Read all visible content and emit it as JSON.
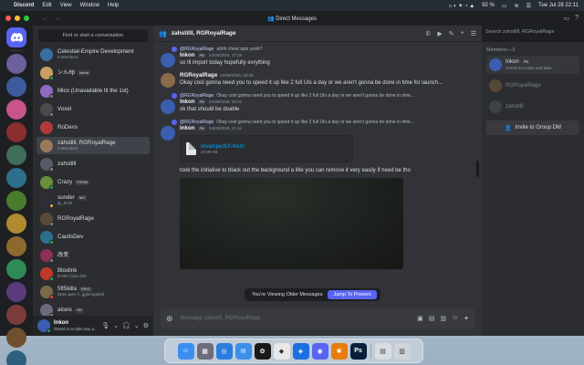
{
  "menubar": {
    "app_name": "Discord",
    "menus": [
      "Edit",
      "View",
      "Window",
      "Help"
    ],
    "battery": "92 %",
    "datetime": "Tue Jul 28  22:11"
  },
  "titlebar": {
    "title": "Direct Messages"
  },
  "guilds": [
    {
      "initials": "",
      "color": "#6d5f9c"
    },
    {
      "initials": "",
      "color": "#3c5a9c"
    },
    {
      "initials": "",
      "color": "#c7548b"
    },
    {
      "initials": "",
      "color": "#8b2e2e"
    },
    {
      "initials": "",
      "color": "#3f6e5a"
    },
    {
      "initials": "",
      "color": "#2e6f8b"
    },
    {
      "initials": "",
      "color": "#4a7c2e"
    },
    {
      "initials": "",
      "color": "#b08a2e"
    },
    {
      "initials": "",
      "color": "#8b6a2e"
    },
    {
      "initials": "",
      "color": "#2e8b57"
    },
    {
      "initials": "",
      "color": "#5a3c7c"
    },
    {
      "initials": "",
      "color": "#7c3c3c"
    },
    {
      "initials": "",
      "color": "#6f4f2e"
    },
    {
      "initials": "",
      "color": "#2e5f7c"
    }
  ],
  "dm_panel": {
    "find_label": "Find or start a conversation",
    "items": [
      {
        "name": "Celestial-Empire Development",
        "sub": "8 Members",
        "tag": "",
        "color": "#3a6ea5",
        "status": ""
      },
      {
        "name": "シんθþ",
        "sub": "",
        "tag": "blend",
        "color": "#c8a060",
        "status": "#23a55a"
      },
      {
        "name": "Mico (Unavailable til the 1st)",
        "sub": "",
        "tag": "",
        "color": "#8e6bbf",
        "status": "#80848e"
      },
      {
        "name": "Voxel",
        "sub": "",
        "tag": "",
        "color": "#4c4c4c",
        "status": "#80848e"
      },
      {
        "name": "RoDevs",
        "sub": "",
        "tag": "",
        "color": "#b03a3a",
        "status": ""
      },
      {
        "name": "zahstilll, RGRoyalRage",
        "sub": "3 Members",
        "tag": "",
        "color": "#9a7a5a",
        "status": ""
      },
      {
        "name": "zahstilll",
        "sub": "",
        "tag": "",
        "color": "#555a66",
        "status": "#80848e"
      },
      {
        "name": "Crazy",
        "sub": "",
        "tag": "FROM",
        "color": "#6a8e3a",
        "status": "#23a55a"
      },
      {
        "name": "sunder",
        "sub": "ily_EVO",
        "tag": "MO",
        "color": "#2e2e3a",
        "status": "#f0b232"
      },
      {
        "name": "RGRoyalRage",
        "sub": "",
        "tag": "",
        "color": "#5a4a3a",
        "status": "#80848e"
      },
      {
        "name": "CaulisDev",
        "sub": "",
        "tag": "",
        "color": "#2e6e8e",
        "status": "#23a55a"
      },
      {
        "name": "改变",
        "sub": "",
        "tag": "",
        "color": "#8e2e5a",
        "status": "#80848e"
      },
      {
        "name": "Bloxlink",
        "sub": "/invite | blox.link",
        "tag": "",
        "color": "#c0392b",
        "status": "#23a55a"
      },
      {
        "name": "5ft5killa",
        "sub": "DMs open // .gg/kriegsfall",
        "tag": "KRIG",
        "color": "#7a6a4a",
        "status": "#f23f43"
      },
      {
        "name": "alceis",
        "sub": "",
        "tag": "HD",
        "color": "#6a6a7a",
        "status": "#80848e"
      }
    ]
  },
  "user_panel": {
    "name": "Inkon",
    "status": "Greed is to take any a..."
  },
  "chat": {
    "header_name": "zahstilll, RGRoyalRage",
    "search_placeholder": "Search zahstilll, RGRoyalRage",
    "messages": [
      {
        "reply_to": "@RGRoyalRage",
        "reply_text": "ahhh chest spin yeah?",
        "author": "Inkon",
        "author_tag": "PB",
        "time": "24/06/2026, 17:28",
        "text": "so Ill import today hopefully evrything",
        "color": "#3a5fb0"
      },
      {
        "reply_to": "",
        "reply_text": "",
        "author": "RGRoyalRage",
        "author_tag": "",
        "time": "24/06/2026, 20:20",
        "text": "Okay cool gonna need you to speed it up like 2 full UIs a day or we aren't gonna be done in time for launch...",
        "color": "#8a6a4a"
      },
      {
        "reply_to": "@RGRoyalRage",
        "reply_text": "Okay cool gonna need you to speed it up like 2 full UIs a day or we aren't gonna be done in time...",
        "author": "Inkon",
        "author_tag": "PB",
        "time": "24/06/2026, 20:31",
        "text": "ok that should be doable",
        "color": "#3a5fb0"
      },
      {
        "reply_to": "@RGRoyalRage",
        "reply_text": "Okay cool gonna need you to speed it up like 2 full UIs a day or we aren't gonna be done in time...",
        "author": "Inkon",
        "author_tag": "PB",
        "time": "24/06/2026, 21:11",
        "text": "",
        "color": "#3a5fb0"
      }
    ],
    "attachment": {
      "filename": "revampedUI.rbxm",
      "size": "20.89 KB"
    },
    "after_text": "took the initiative to black out the background a litle you can remove it very easily if need be tho",
    "older_label": "You're Viewing Older Messages",
    "jump_label": "Jump To Present",
    "composer_placeholder": "Message zahstilll, RGRoyalRage"
  },
  "members": {
    "header": "Members—3",
    "items": [
      {
        "name": "Inkon",
        "tag": "PB",
        "sub": "Greed is to take and take...",
        "color": "#3a5fb0",
        "dim": false
      },
      {
        "name": "RGRoyalRage",
        "tag": "",
        "sub": "",
        "color": "#8a6a4a",
        "dim": true
      },
      {
        "name": "zahstilll",
        "tag": "",
        "sub": "",
        "color": "#555a66",
        "dim": true
      }
    ],
    "invite_label": "Invite to Group DM"
  },
  "dock": [
    {
      "name": "finder",
      "color": "#3b8ef0",
      "glyph": "☺"
    },
    {
      "name": "launchpad",
      "color": "#6c6c7a",
      "glyph": "▦"
    },
    {
      "name": "safari",
      "color": "#2b7de0",
      "glyph": "◎"
    },
    {
      "name": "mail",
      "color": "#3d8fe8",
      "glyph": "✉"
    },
    {
      "name": "openai",
      "color": "#1a1a1a",
      "glyph": "✿"
    },
    {
      "name": "roblox",
      "color": "#e8e8e8",
      "glyph": "◆"
    },
    {
      "name": "roblox-studio",
      "color": "#1c6fe0",
      "glyph": "◈"
    },
    {
      "name": "discord",
      "color": "#5865f2",
      "glyph": "◉"
    },
    {
      "name": "blender",
      "color": "#e87d0d",
      "glyph": "✺"
    },
    {
      "name": "photoshop",
      "color": "#0b1f3a",
      "glyph": "Ps"
    },
    {
      "name": "downloads",
      "color": "#d8dde3",
      "glyph": "▤"
    },
    {
      "name": "trash",
      "color": "#cfd4da",
      "glyph": "▥"
    }
  ]
}
